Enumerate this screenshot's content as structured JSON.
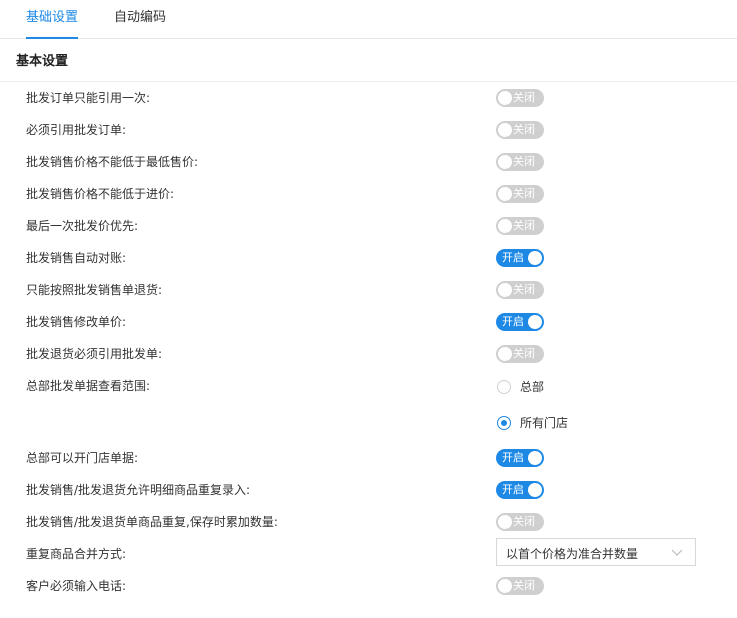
{
  "tabs": [
    {
      "label": "基础设置",
      "active": true
    },
    {
      "label": "自动编码",
      "active": false
    }
  ],
  "section": {
    "title": "基本设置"
  },
  "switch_text": {
    "on": "开启",
    "off": "关闭"
  },
  "settings": [
    {
      "label": "批发订单只能引用一次:",
      "state": "off"
    },
    {
      "label": "必须引用批发订单:",
      "state": "off"
    },
    {
      "label": "批发销售价格不能低于最低售价:",
      "state": "off"
    },
    {
      "label": "批发销售价格不能低于进价:",
      "state": "off"
    },
    {
      "label": "最后一次批发价优先:",
      "state": "off"
    },
    {
      "label": "批发销售自动对账:",
      "state": "on"
    },
    {
      "label": "只能按照批发销售单退货:",
      "state": "off"
    },
    {
      "label": "批发销售修改单价:",
      "state": "on"
    },
    {
      "label": "批发退货必须引用批发单:",
      "state": "off"
    }
  ],
  "scope": {
    "label": "总部批发单据查看范围:",
    "options": [
      {
        "label": "总部",
        "selected": false
      },
      {
        "label": "所有门店",
        "selected": true
      }
    ]
  },
  "settings2": [
    {
      "label": "总部可以开门店单据:",
      "state": "on"
    },
    {
      "label": "批发销售/批发退货允许明细商品重复录入:",
      "state": "on"
    },
    {
      "label": "批发销售/批发退货单商品重复,保存时累加数量:",
      "state": "off"
    }
  ],
  "merge": {
    "label": "重复商品合并方式:",
    "value": "以首个价格为准合并数量"
  },
  "phone": {
    "label": "客户必须输入电话:",
    "state": "off"
  },
  "colors": {
    "accent": "#1e88e5",
    "switch_off": "#cfcfcf"
  },
  "icons": {
    "select_chevron": "chevron-down-icon"
  }
}
